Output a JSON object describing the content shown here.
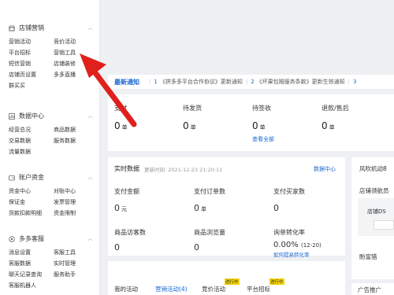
{
  "sidebar": {
    "store_marketing": {
      "title": "店铺营销",
      "items": [
        "营销活动",
        "竞价活动",
        "平台招标",
        "营销工具",
        "短信营销",
        "店铺装修",
        "店铺页设置",
        "多多直播",
        "群买买"
      ]
    },
    "data_center": {
      "title": "数据中心",
      "items": [
        "经营总况",
        "商品数据",
        "交易数据",
        "服务数据",
        "流量数据"
      ]
    },
    "account_funds": {
      "title": "账户资金",
      "items": [
        "资金中心",
        "对账中心",
        "保证金",
        "发票管理",
        "货款扣款明细",
        "资金限制"
      ]
    },
    "customer_service": {
      "title": "多多客服",
      "items": [
        "消息设置",
        "客服工具",
        "客服数据",
        "实时管理",
        "聊天记录查询",
        "服务助手",
        "客服机器人"
      ]
    }
  },
  "notice": {
    "title": "最新通知",
    "items": [
      {
        "num": "1",
        "text": "《拼多多平台合作协议》更新通知"
      },
      {
        "num": "2",
        "text": "《坏果包赔服务条款》更新生效通知"
      },
      {
        "num": "3",
        "text": ""
      }
    ]
  },
  "orders": {
    "pending_pay": {
      "label": "支付",
      "value": "0",
      "unit": "单"
    },
    "pending_ship": {
      "label": "待发货",
      "value": "0",
      "unit": "单"
    },
    "pending_receive": {
      "label": "待签收",
      "value": "0",
      "unit": "单"
    },
    "refund": {
      "label": "退款/售后",
      "value": "0",
      "unit": "单"
    },
    "view_all": "查看全部"
  },
  "realtime": {
    "title": "实时数据",
    "updated_prefix": "更新时间:",
    "updated_time": "2021-12-23 21:20:11",
    "link": "数据中心",
    "pay_amount": {
      "label": "支付金额",
      "value": "0",
      "unit": "元"
    },
    "pay_orders": {
      "label": "支付订单数",
      "value": "0",
      "unit": "单"
    },
    "pay_buyers": {
      "label": "支付买家数",
      "value": "0"
    },
    "visitors": {
      "label": "商品访客数",
      "value": "0"
    },
    "views": {
      "label": "商品浏览量",
      "value": "0"
    },
    "conversion": {
      "label": "询单转化率",
      "value": "0.00%",
      "range": "(12-20)",
      "link": "如何提高转化率"
    }
  },
  "right_panel": {
    "title": "风吹机动8",
    "staff_title": "店铺领航员",
    "staff_text": "店铺DS",
    "manager": "盼富猎",
    "ad": "广告推广"
  },
  "activities": {
    "title": "我的活动",
    "tabs": [
      {
        "label": "营销活动(4)",
        "badge": ""
      },
      {
        "label": "竞价活动",
        "badge": "进行中"
      },
      {
        "label": "平台招标",
        "badge": "进行中"
      }
    ]
  },
  "colors": {
    "accent": "#1a67d2",
    "arrow": "#e0201c",
    "badge": "#f5d300"
  }
}
